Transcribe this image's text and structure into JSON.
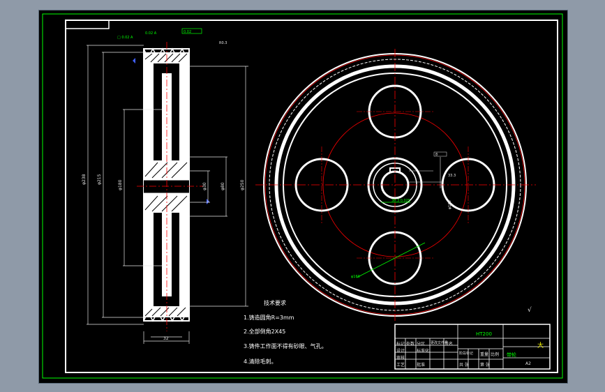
{
  "dims": {
    "overall_dia": "φ238",
    "dia_2": "φ215",
    "hub_dia": "φ180",
    "bore_dia": "φ30",
    "dia_5": "φ80",
    "outer_dia": "φ250",
    "width": "32",
    "tol_bore": "38.3 0.025",
    "key_width": "8",
    "key_depth": "33.3",
    "pcd_note": "φ160",
    "top_tol_1": "0.02 A",
    "top_tol_2": "0.02",
    "note_top_a": "□ 0.02 A",
    "note_top_b": "R0.3"
  },
  "tech_requirements": {
    "title": "技术要求",
    "items": [
      "1.铸造圆角R=3mm",
      "2.全部倒角2X45",
      "3.铸件工作面不得有砂眼、气孔。",
      "4.清除毛刺。"
    ]
  },
  "title_block": {
    "material": "HT200",
    "part_name": "大",
    "part_name_2": "带轮",
    "sheet_size": "A2",
    "cells": [
      "标记",
      "处数",
      "分区",
      "更改文件号",
      "签名",
      "年月日",
      "设计",
      "标准化",
      "阶段标记",
      "重量",
      "比例",
      "审核",
      "工艺",
      "批准",
      "共  张",
      "第  张"
    ]
  },
  "roughness": {
    "general": "√"
  },
  "colors": {
    "background": "#000000",
    "frame_green": "#00ff00",
    "line_white": "#ffffff",
    "center_red": "#ff0000",
    "dim_white": "#e6e6e6",
    "hatch": "#ffffff",
    "note_green": "#00ff00",
    "blue_marker": "#4060ff"
  }
}
